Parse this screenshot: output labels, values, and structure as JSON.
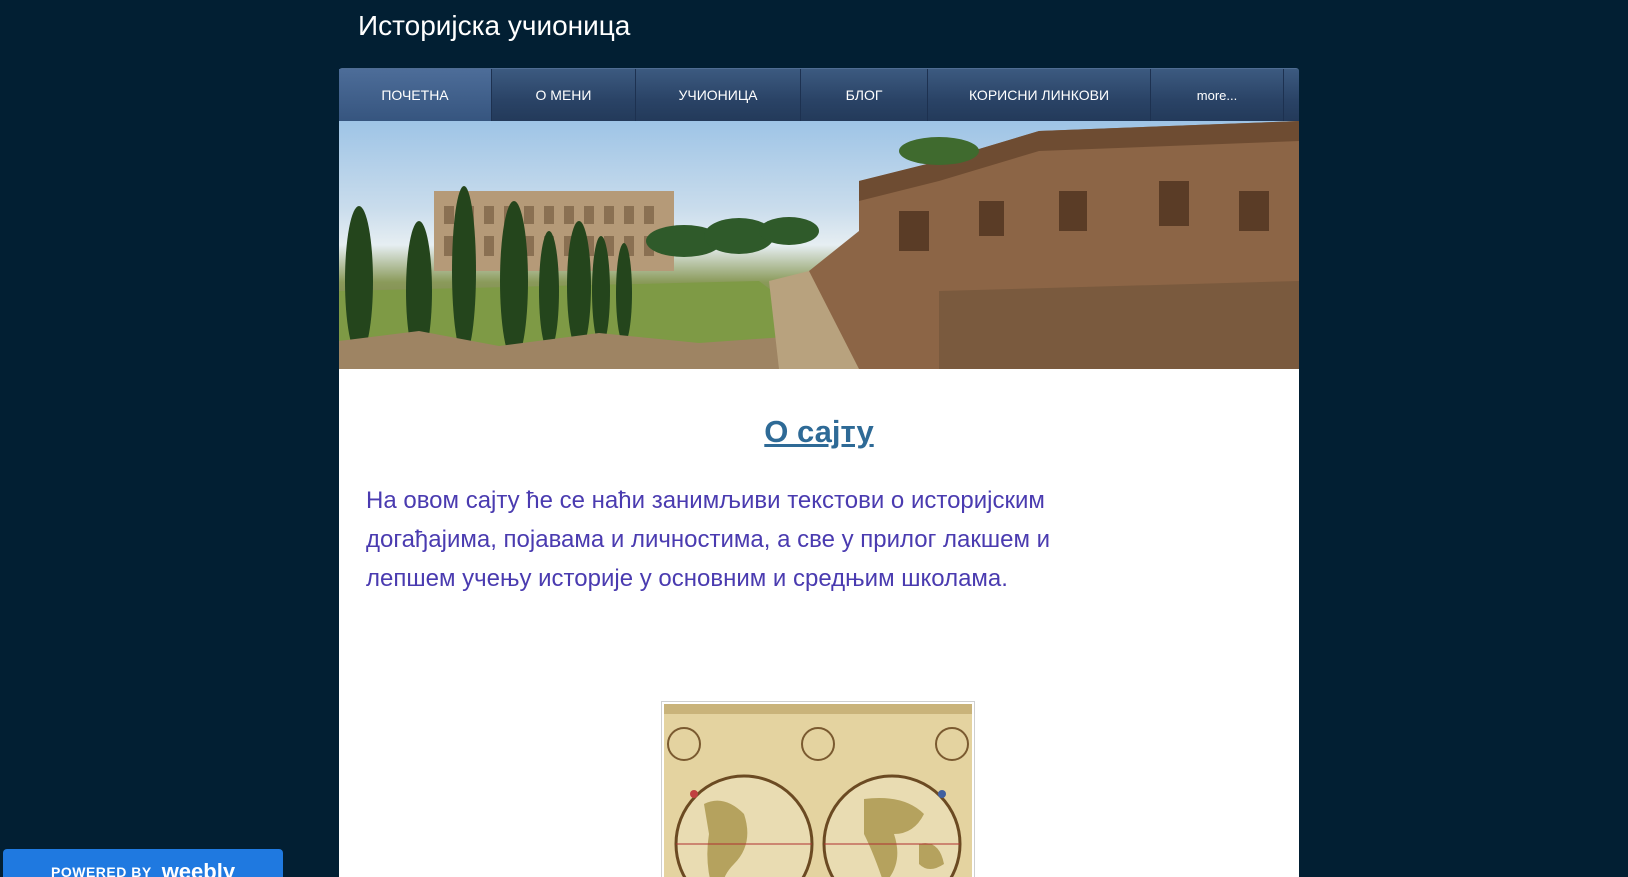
{
  "site": {
    "title": "Историјска учионица"
  },
  "nav": {
    "items": [
      {
        "label": "Почетна",
        "active": true
      },
      {
        "label": "О мени",
        "active": false
      },
      {
        "label": "Учионица",
        "active": false
      },
      {
        "label": "Блог",
        "active": false
      },
      {
        "label": "Корисни линкови",
        "active": false
      },
      {
        "label": "more...",
        "active": false
      }
    ]
  },
  "main": {
    "heading": "О сајту",
    "intro": "На овом сајту ће се наћи занимљиви текстови о историјским догађајима, појавама и личностима, а све у прилог лакшем и лепшем учењу историје у основним и средњим школама."
  },
  "footer_badge": {
    "powered_by": "POWERED BY",
    "brand": "weebly"
  },
  "colors": {
    "background": "#021f33",
    "heading": "#2e6a96",
    "intro_text": "#4a3bb0",
    "badge": "#1f79e0"
  }
}
